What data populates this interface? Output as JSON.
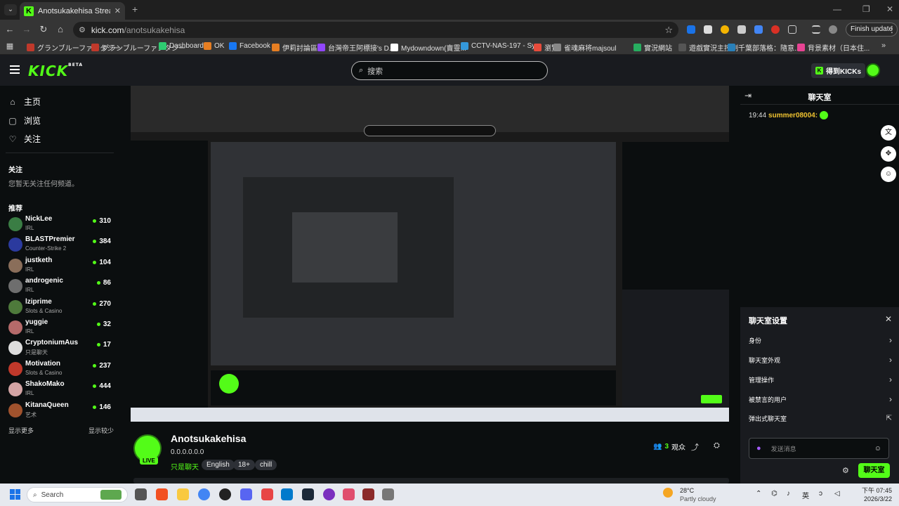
{
  "browser": {
    "tab_title": "Anotsukakehisa Stream - Watc",
    "tab_close": "✕",
    "new_tab": "+",
    "url_host": "kick.com",
    "url_path": "/anotsukakehisa",
    "finish_update": "Finish update"
  },
  "bookmarks": [
    {
      "label": "グランブルーファンタジー",
      "color": "#c0392b"
    },
    {
      "label": "グランブルーファンタジー",
      "color": "#c0392b"
    },
    {
      "label": "Dashboard",
      "color": "#2ecc71"
    },
    {
      "label": "OK",
      "color": "#e67e22"
    },
    {
      "label": "Facebook",
      "color": "#1877f2"
    },
    {
      "label": "伊莉討論區",
      "color": "#e67e22"
    },
    {
      "label": "台灣帝王阿標接's D...",
      "color": "#9146ff"
    },
    {
      "label": "Mydowndown(賣靈...",
      "color": "#ffffff"
    },
    {
      "label": "CCTV-NAS-197 - Sy...",
      "color": "#3498db"
    },
    {
      "label": "瀏覽",
      "color": "#e74c3c"
    },
    {
      "label": "雀魂麻将majsoul",
      "color": "#888888"
    },
    {
      "label": "實況網站",
      "color": "#27ae60"
    },
    {
      "label": "遊戲實況主控制",
      "color": "#555555"
    },
    {
      "label": "千葉部落格：隨意...",
      "color": "#2980b9"
    },
    {
      "label": "背景素材（日本住...",
      "color": "#e84393"
    }
  ],
  "kick": {
    "logo": "KICK",
    "beta": "BETA",
    "search_placeholder": "搜索",
    "get_kicks": "得到KICKs"
  },
  "sidebar": {
    "nav": [
      {
        "icon": "home-icon",
        "label": "主页"
      },
      {
        "icon": "browse-icon",
        "label": "浏览"
      },
      {
        "icon": "heart-icon",
        "label": "关注"
      }
    ],
    "following_title": "关注",
    "following_empty": "您暂无关注任何频道。",
    "recommended_title": "推荐",
    "recommended": [
      {
        "name": "NickLee",
        "category": "IRL",
        "viewers": "310",
        "color": "#3a7d44"
      },
      {
        "name": "BLASTPremier",
        "category": "Counter-Strike 2",
        "viewers": "384",
        "color": "#2b3a9e"
      },
      {
        "name": "justketh",
        "category": "IRL",
        "viewers": "104",
        "color": "#8a6e5a"
      },
      {
        "name": "androgenic",
        "category": "IRL",
        "viewers": "86",
        "color": "#6e6e6e"
      },
      {
        "name": "lziprime",
        "category": "Slots & Casino",
        "viewers": "270",
        "color": "#4e7a3b"
      },
      {
        "name": "yuggie",
        "category": "IRL",
        "viewers": "32",
        "color": "#b56a6a"
      },
      {
        "name": "CryptoniumAus",
        "category": "只是聊天",
        "viewers": "17",
        "color": "#ddd"
      },
      {
        "name": "Motivation",
        "category": "Slots & Casino",
        "viewers": "237",
        "color": "#c0392b"
      },
      {
        "name": "ShakoMako",
        "category": "IRL",
        "viewers": "444",
        "color": "#d4a5a5"
      },
      {
        "name": "KitanaQueen",
        "category": "艺术",
        "viewers": "146",
        "color": "#a0522d"
      }
    ],
    "show_more": "显示更多",
    "show_less": "显示较少"
  },
  "channel": {
    "name": "Anotsukakehisa",
    "title": "0.0.0.0.0.0",
    "category": "只是聊天",
    "tags": [
      "English",
      "18+",
      "chill"
    ],
    "live": "LIVE",
    "viewers": "3",
    "viewers_label": "观众"
  },
  "chat": {
    "title": "聊天室",
    "message": {
      "time": "19:44",
      "user": "summer08004:"
    },
    "settings": {
      "title": "聊天室设置",
      "items": [
        "身份",
        "聊天室外观",
        "管理操作",
        "被禁言的用户",
        "弹出式聊天室"
      ]
    },
    "send_placeholder": "发送消息",
    "send_button": "聊天室"
  },
  "taskbar": {
    "search": "Search",
    "weather_temp": "28°C",
    "weather_desc": "Partly cloudy",
    "ime": "英",
    "time": "下午 07:45",
    "date": "2026/3/22"
  }
}
